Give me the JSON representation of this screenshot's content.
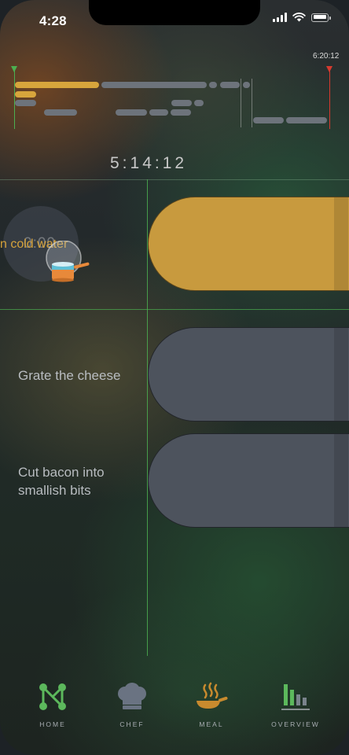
{
  "status_bar": {
    "time": "4:28"
  },
  "timeline": {
    "end_time": "6:20:12",
    "elapsed": "5:14:12",
    "colors": {
      "start_marker": "#4caf50",
      "end_marker": "#d63a2f",
      "active": "#d7a53c",
      "inactive": "#6d737b"
    }
  },
  "tasks": [
    {
      "label": "n cold water",
      "timer": "0:00",
      "state": "active",
      "color": "#c89a3e",
      "icon": "pot-icon"
    },
    {
      "label": "Grate the cheese",
      "state": "pending",
      "color": "#4d535d"
    },
    {
      "label": "Cut bacon into\nsmallish bits",
      "state": "pending",
      "color": "#4d535d"
    }
  ],
  "nav": {
    "items": [
      {
        "label": "HOME",
        "icon": "home-network-icon",
        "color": "#5cb85c"
      },
      {
        "label": "CHEF",
        "icon": "chef-hat-icon",
        "color": "#6a7382"
      },
      {
        "label": "MEAL",
        "icon": "frying-pan-icon",
        "color": "#c88a2e"
      },
      {
        "label": "OVERVIEW",
        "icon": "bar-chart-icon",
        "color": "#5cb85c"
      }
    ]
  }
}
